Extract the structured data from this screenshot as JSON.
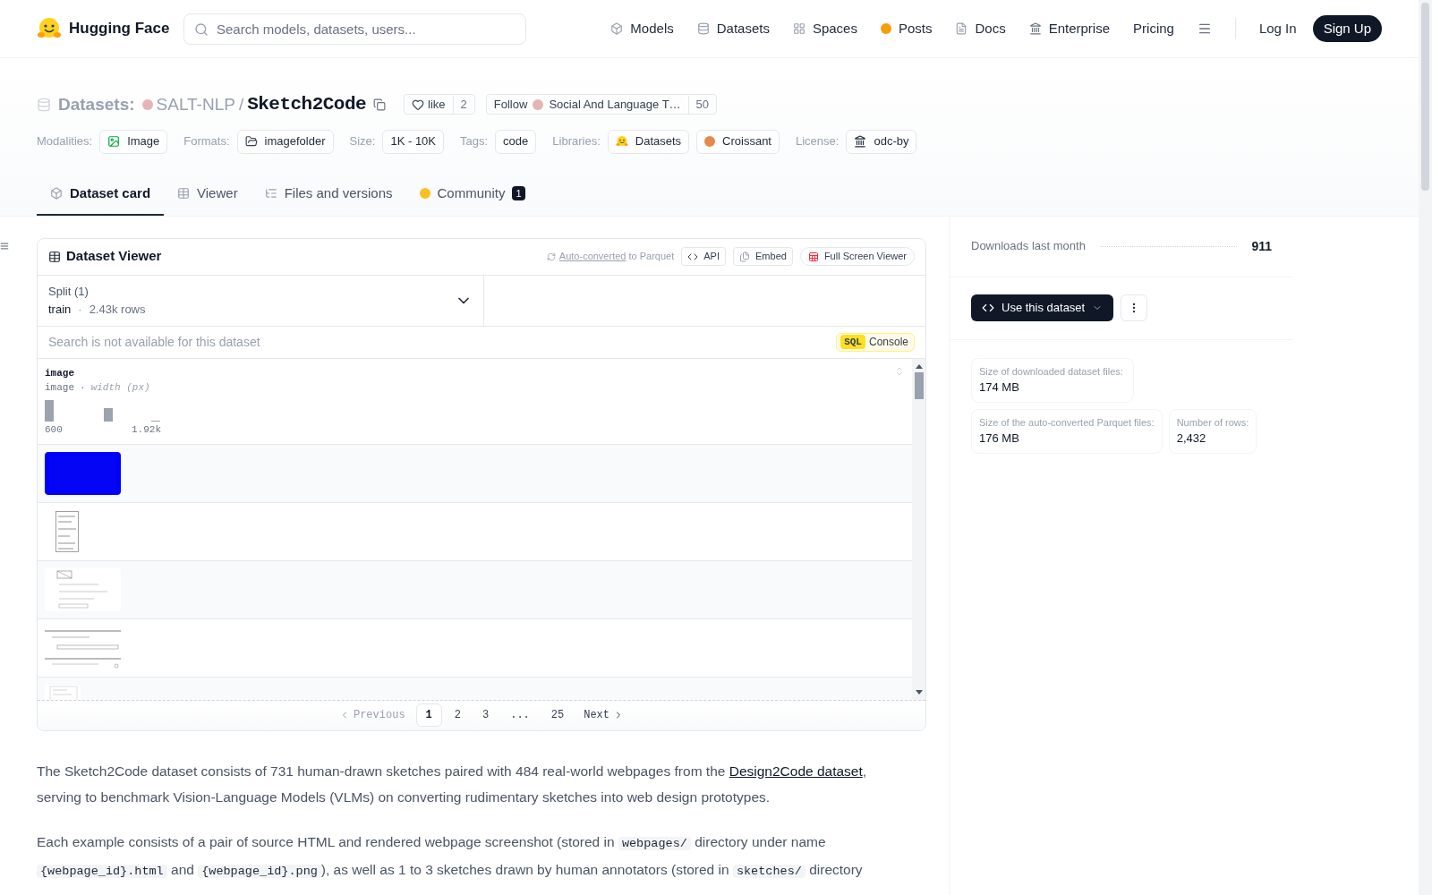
{
  "header": {
    "brand": "Hugging Face",
    "search": {
      "placeholder": "Search models, datasets, users..."
    },
    "nav": [
      "Models",
      "Datasets",
      "Spaces",
      "Posts",
      "Docs",
      "Enterprise",
      "Pricing"
    ],
    "login": "Log In",
    "signup": "Sign Up"
  },
  "dataset": {
    "type_label": "Datasets:",
    "owner": "SALT-NLP",
    "separator": "/",
    "name": "Sketch2Code",
    "like": {
      "label": "like",
      "count": "2"
    },
    "follow": {
      "label": "Follow",
      "org": "Social And Language T…",
      "count": "50"
    },
    "meta": [
      {
        "label": "Modalities:",
        "tags": [
          "Image"
        ]
      },
      {
        "label": "Formats:",
        "tags": [
          "imagefolder"
        ]
      },
      {
        "label": "Size:",
        "tags": [
          "1K - 10K"
        ]
      },
      {
        "label": "Tags:",
        "tags": [
          "code"
        ]
      },
      {
        "label": "Libraries:",
        "tags": [
          "Datasets",
          "Croissant"
        ]
      },
      {
        "label": "License:",
        "tags": [
          "odc-by"
        ]
      }
    ]
  },
  "tabs": [
    {
      "label": "Dataset card",
      "selected": true
    },
    {
      "label": "Viewer",
      "selected": false
    },
    {
      "label": "Files and versions",
      "selected": false
    },
    {
      "label": "Community",
      "selected": false,
      "badge": "1"
    }
  ],
  "viewer": {
    "title": "Dataset Viewer",
    "auto_converted": "Auto-converted",
    "to_parquet": "to Parquet",
    "buttons": [
      "API",
      "Embed",
      "Full Screen Viewer"
    ],
    "split": {
      "label": "Split (1)",
      "name": "train",
      "separator": "·",
      "rows": "2.43k rows"
    },
    "search_placeholder": "Search is not available for this dataset",
    "sql": {
      "badge": "SQL",
      "label": "Console"
    },
    "column": {
      "name": "image",
      "type": "image",
      "separator": "·",
      "stat": "width (px)",
      "min": "600",
      "max": "1.92k"
    },
    "rows": [
      {
        "kind": "picture"
      },
      {
        "kind": "picture"
      },
      {
        "kind": "picture"
      },
      {
        "kind": "picture"
      },
      {
        "kind": "picture"
      }
    ],
    "pagination": {
      "previous": "Previous",
      "pages": [
        {
          "label": "1",
          "selected": true
        },
        {
          "label": "2",
          "selected": false
        },
        {
          "label": "3",
          "selected": false
        },
        {
          "label": "...",
          "selected": false
        },
        {
          "label": "25",
          "selected": false
        }
      ],
      "next": "Next"
    }
  },
  "sidebar": {
    "downloads": {
      "label": "Downloads last month",
      "value": "911"
    },
    "use_button": "Use this dataset",
    "stats": [
      {
        "label": "Size of downloaded dataset files:",
        "value": "174 MB"
      },
      {
        "label": "Size of the auto-converted Parquet files:",
        "value": "176 MB"
      },
      {
        "label": "Number of rows:",
        "value": "2,432"
      }
    ]
  },
  "card": {
    "paragraphs": [
      [
        {
          "kind": "text",
          "text": "The Sketch2Code dataset consists of 731 human-drawn sketches paired with 484 real-world webpages from the "
        },
        {
          "kind": "link",
          "text": "Design2Code dataset"
        },
        {
          "kind": "text",
          "text": ", serving to benchmark Vision-Language Models (VLMs) on converting rudimentary sketches into web design prototypes."
        }
      ],
      [
        {
          "kind": "text",
          "text": "Each example consists of a pair of source HTML and rendered webpage screenshot (stored in "
        },
        {
          "kind": "code",
          "text": "webpages/"
        },
        {
          "kind": "text",
          "text": " directory under name "
        },
        {
          "kind": "code",
          "text": "{webpage_id}.html"
        },
        {
          "kind": "text",
          "text": " and "
        },
        {
          "kind": "code",
          "text": "{webpage_id}.png"
        },
        {
          "kind": "text",
          "text": "), as well as 1 to 3 sketches drawn by human annotators (stored in "
        },
        {
          "kind": "code",
          "text": "sketches/"
        },
        {
          "kind": "text",
          "text": " directory"
        }
      ]
    ]
  }
}
